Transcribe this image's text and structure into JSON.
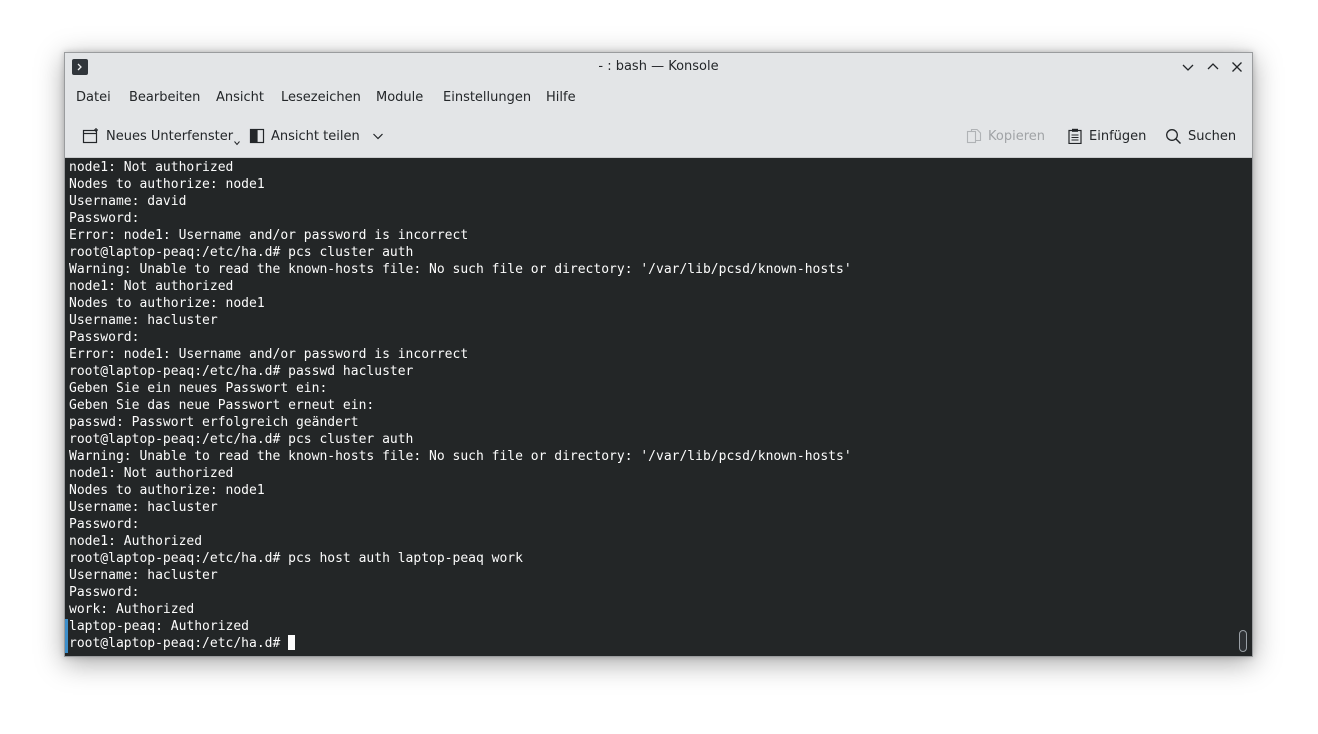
{
  "window": {
    "title": "- : bash — Konsole"
  },
  "menubar": {
    "items": [
      "Datei",
      "Bearbeiten",
      "Ansicht",
      "Lesezeichen",
      "Module",
      "Einstellungen",
      "Hilfe"
    ]
  },
  "toolbar": {
    "new_tab_label": "Neues Unterfenster",
    "split_view_label": "Ansicht teilen",
    "copy_label": "Kopieren",
    "paste_label": "Einfügen",
    "search_label": "Suchen"
  },
  "colors": {
    "terminal_bg": "#232627",
    "terminal_fg": "#fcfcfc",
    "accent": "#3d8ec9"
  },
  "terminal": {
    "lines": [
      "node1: Not authorized",
      "Nodes to authorize: node1",
      "Username: david",
      "Password:",
      "Error: node1: Username and/or password is incorrect",
      "root@laptop-peaq:/etc/ha.d# pcs cluster auth",
      "Warning: Unable to read the known-hosts file: No such file or directory: '/var/lib/pcsd/known-hosts'",
      "node1: Not authorized",
      "Nodes to authorize: node1",
      "Username: hacluster",
      "Password:",
      "Error: node1: Username and/or password is incorrect",
      "root@laptop-peaq:/etc/ha.d# passwd hacluster",
      "Geben Sie ein neues Passwort ein:",
      "Geben Sie das neue Passwort erneut ein:",
      "passwd: Passwort erfolgreich geändert",
      "root@laptop-peaq:/etc/ha.d# pcs cluster auth",
      "Warning: Unable to read the known-hosts file: No such file or directory: '/var/lib/pcsd/known-hosts'",
      "node1: Not authorized",
      "Nodes to authorize: node1",
      "Username: hacluster",
      "Password:",
      "node1: Authorized",
      "root@laptop-peaq:/etc/ha.d# pcs host auth laptop-peaq work",
      "Username: hacluster",
      "Password:",
      "work: Authorized",
      "laptop-peaq: Authorized"
    ],
    "prompt": "root@laptop-peaq:/etc/ha.d# "
  }
}
